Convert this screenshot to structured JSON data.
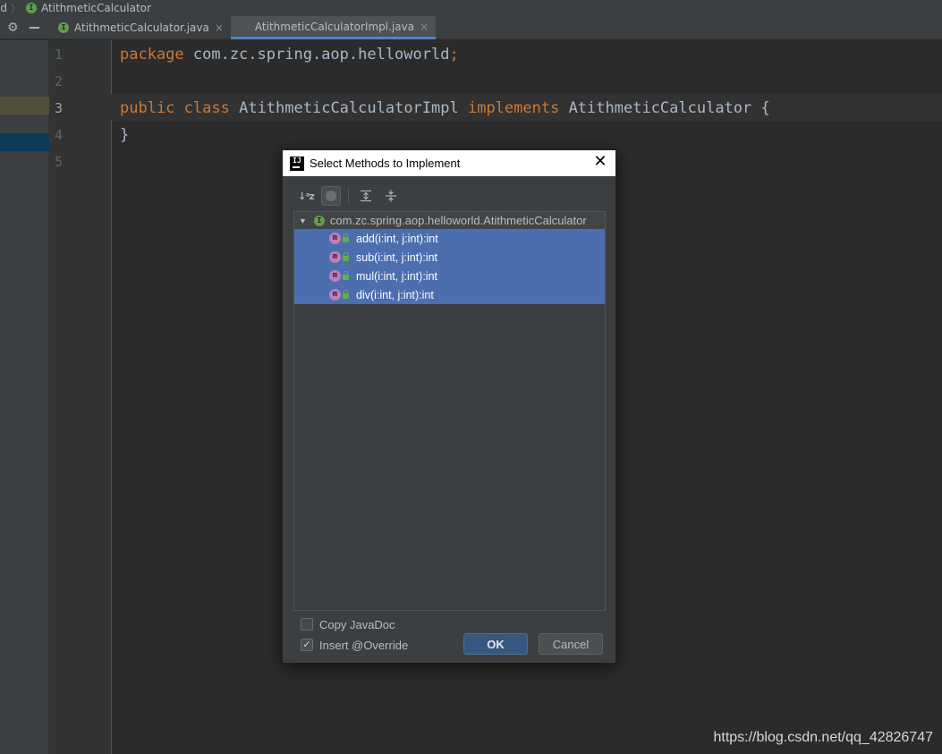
{
  "breadcrumb": {
    "items": [
      "ld",
      "AtithmeticCalculator"
    ],
    "separator": "〉",
    "icon": "interface-icon"
  },
  "toolstrip": {
    "settings_icon": "gear-icon",
    "hide_icon": "minus-icon"
  },
  "tabs": [
    {
      "label": "AtithmeticCalculator.java",
      "icon": "interface-icon",
      "close": "×",
      "active": false
    },
    {
      "label": "AtithmeticCalculatorImpl.java",
      "close": "×",
      "active": true
    }
  ],
  "editor": {
    "line_numbers": [
      "1",
      "2",
      "3",
      "4",
      "5"
    ],
    "current_line": "3",
    "lines": [
      {
        "kw1": "package",
        "text": " com.zc.spring.aop.helloworld",
        "tail": ";"
      },
      {},
      {
        "kw1": "public",
        "sp": " ",
        "kw2": "class",
        "mid": " AtithmeticCalculatorImpl ",
        "kw3": "implements",
        "text": " AtithmeticCalculator {"
      },
      {
        "text": "}"
      },
      {}
    ],
    "colors": {
      "keyword": "#cc7832",
      "text": "#a9b7c6",
      "background": "#2b2b2b"
    }
  },
  "dialog": {
    "title": "Select Methods to Implement",
    "app_icon": "IJ",
    "close_glyph": "✕",
    "toolbar": [
      "sort-alphabetically-icon",
      "show-classes-icon",
      "expand-all-icon",
      "collapse-all-icon"
    ],
    "tree": {
      "root": "com.zc.spring.aop.helloworld.AtithmeticCalculator",
      "root_icon": "I",
      "method_icon": "m",
      "methods": [
        "add(i:int, j:int):int",
        "sub(i:int, j:int):int",
        "mul(i:int, j:int):int",
        "div(i:int, j:int):int"
      ],
      "selection_color": "#4b6eaf"
    },
    "options": {
      "copy_javadoc": {
        "label": "Copy JavaDoc",
        "checked": false
      },
      "insert_override": {
        "label": "Insert @Override",
        "checked": true,
        "check_glyph": "✓"
      }
    },
    "ok_label": "OK",
    "cancel_label": "Cancel"
  },
  "watermark": "https://blog.csdn.net/qq_42826747"
}
